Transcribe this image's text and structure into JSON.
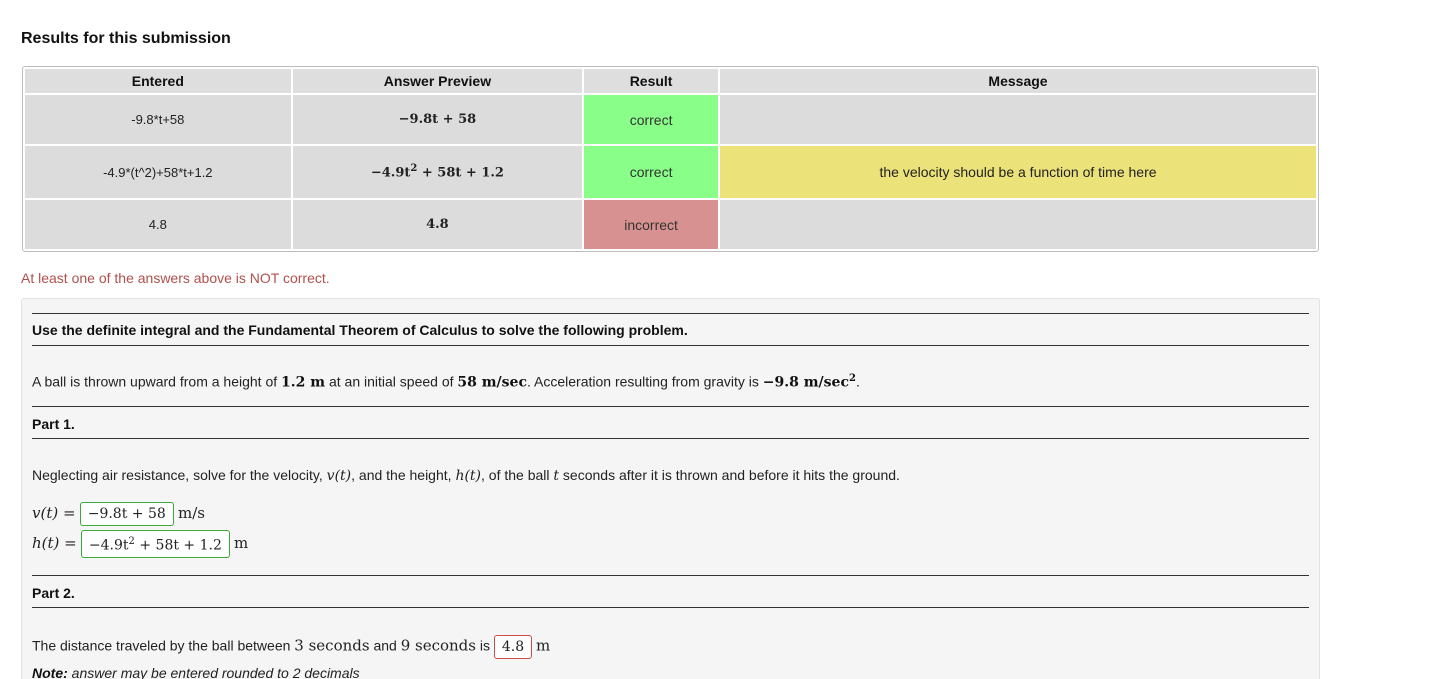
{
  "heading": "Results for this submission",
  "table": {
    "headers": [
      "Entered",
      "Answer Preview",
      "Result",
      "Message"
    ],
    "rows": [
      {
        "entered": "-9.8*t+58",
        "preview": "−9.8t + 58",
        "result": "correct",
        "message": ""
      },
      {
        "entered": "-4.9*(t^2)+58*t+1.2",
        "preview_main": "−4.9t",
        "preview_sup": "2",
        "preview_rest": " + 58t + 1.2",
        "result": "correct",
        "message": "the velocity should be a function of time here"
      },
      {
        "entered": "4.8",
        "preview": "4.8",
        "result": "incorrect",
        "message": ""
      }
    ]
  },
  "warning": "At least one of the answers above is NOT correct.",
  "problem": {
    "instruction": "Use the definite integral and the Fundamental Theorem of Calculus to solve the following problem.",
    "statement": {
      "p1": "A ball is thrown upward from a height of ",
      "h0": "1.2 m",
      "p2": " at an initial speed of ",
      "v0": "58 m/sec",
      "p3": ". Acceleration resulting from gravity is ",
      "g": "−9.8 m/sec",
      "g_sup": "2",
      "p4": "."
    },
    "part1": {
      "label": "Part 1.",
      "text_a": "Neglecting air resistance, solve for the velocity, ",
      "v_sym": "v(t)",
      "text_b": ", and the height, ",
      "h_sym": "h(t)",
      "text_c": ", of the ball ",
      "t_sym": "t",
      "text_d": " seconds after it is thrown and before it hits the ground.",
      "v_lhs": "v(t) =",
      "v_answer": "−9.8t + 58",
      "v_unit": "m/s",
      "h_lhs": "h(t) =",
      "h_answer_main": "−4.9t",
      "h_answer_sup": "2",
      "h_answer_rest": " + 58t + 1.2",
      "h_unit": "m"
    },
    "part2": {
      "label": "Part 2.",
      "text_a": "The distance traveled by the ball between ",
      "t1": "3 seconds",
      "text_b": " and ",
      "t2": "9 seconds",
      "text_c": " is ",
      "answer": "4.8",
      "unit": "m",
      "note_label": "Note:",
      "note_text": " answer may be entered rounded to 2 decimals"
    }
  },
  "colors": {
    "correct": "#89ff89",
    "incorrect": "#d79191",
    "message_warn": "#ece27a",
    "warning_text": "#b0504c"
  }
}
